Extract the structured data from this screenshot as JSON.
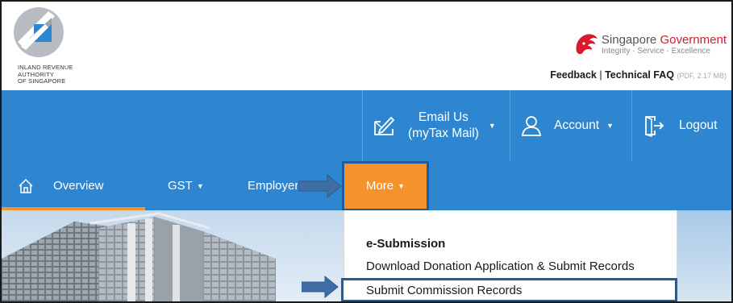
{
  "header": {
    "iras_logo_lines": [
      "INLAND REVENUE",
      "AUTHORITY",
      "OF SINGAPORE"
    ],
    "sg_gov": {
      "title_part1": "Singapore ",
      "title_part2": "Government",
      "tagline": "Integrity · Service · Excellence"
    },
    "links": {
      "feedback": "Feedback",
      "separator": "|",
      "technical_faq": "Technical FAQ",
      "faq_note": "(PDF, 2.17 MB)"
    }
  },
  "topbar": {
    "email": {
      "line1": "Email Us",
      "line2": "(myTax Mail)",
      "caret": "▼"
    },
    "account": {
      "label": "Account",
      "caret": "▼"
    },
    "logout": {
      "label": "Logout"
    }
  },
  "mainnav": {
    "overview": "Overview",
    "gst": "GST",
    "employer": "Employer",
    "more": "More",
    "caret": "▼"
  },
  "dropdown": {
    "heading": "e-Submission",
    "items": [
      "Download Donation Application & Submit Records",
      "Submit Commission Records"
    ]
  },
  "colors": {
    "nav_blue": "#2e86d0",
    "accent_orange": "#f5922b",
    "highlight_border": "#1c5f9e",
    "gov_red": "#d8192e"
  },
  "icons": {
    "email": "mail-edit-icon",
    "account": "user-icon",
    "logout": "logout-icon",
    "overview": "home-icon"
  }
}
